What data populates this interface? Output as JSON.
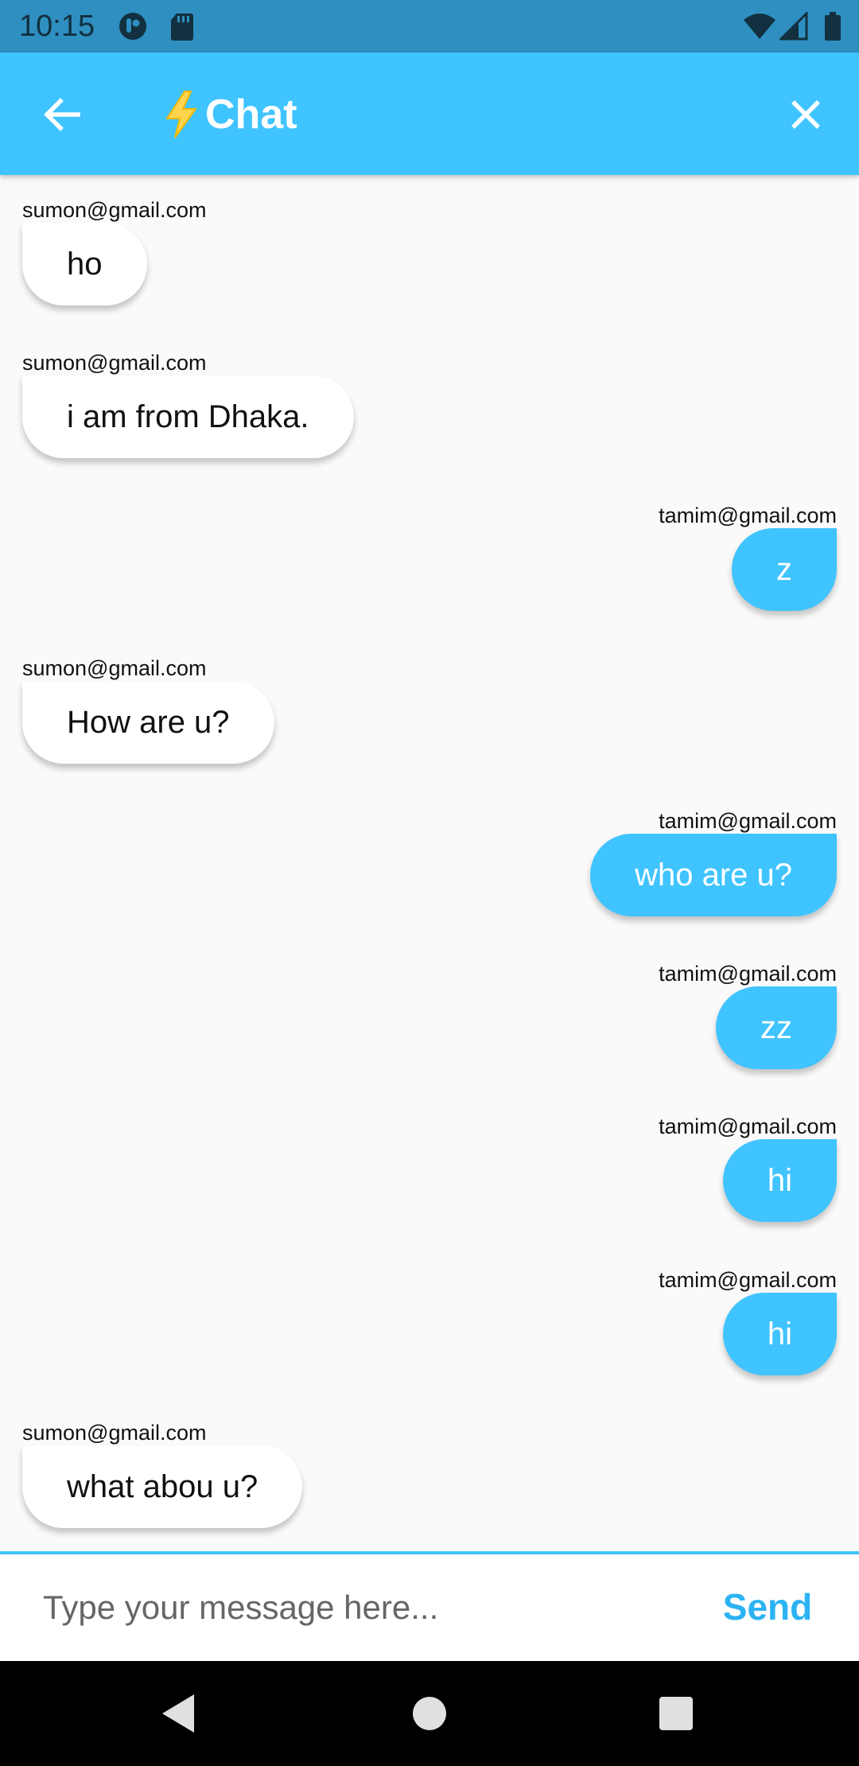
{
  "status_bar": {
    "time": "10:15",
    "icons": [
      "app-notification-icon",
      "sd-card-icon",
      "wifi-icon",
      "cellular-signal-icon",
      "battery-icon"
    ]
  },
  "app_bar": {
    "title": "Chat",
    "title_icon": "lightning-bolt-icon",
    "back_icon": "arrow-back-icon",
    "close_icon": "close-icon",
    "background": "#40C4FF",
    "bolt_color": "#FFD54F"
  },
  "messages": [
    {
      "sender": "sumon@gmail.com",
      "text": "ho",
      "direction": "received"
    },
    {
      "sender": "sumon@gmail.com",
      "text": "i am from Dhaka.",
      "direction": "received"
    },
    {
      "sender": "tamim@gmail.com",
      "text": "z",
      "direction": "sent"
    },
    {
      "sender": "sumon@gmail.com",
      "text": "How are u?",
      "direction": "received"
    },
    {
      "sender": "tamim@gmail.com",
      "text": "who are u?",
      "direction": "sent"
    },
    {
      "sender": "tamim@gmail.com",
      "text": "zz",
      "direction": "sent"
    },
    {
      "sender": "tamim@gmail.com",
      "text": "hi",
      "direction": "sent"
    },
    {
      "sender": "tamim@gmail.com",
      "text": "hi",
      "direction": "sent"
    },
    {
      "sender": "sumon@gmail.com",
      "text": "what abou u?",
      "direction": "received"
    }
  ],
  "composer": {
    "placeholder": "Type your message here...",
    "value": "",
    "send_label": "Send"
  },
  "nav_bar": {
    "buttons": [
      "nav-back-icon",
      "nav-home-icon",
      "nav-recents-icon"
    ]
  },
  "colors": {
    "accent": "#40C4FF",
    "status_bar": "#2E8FC0",
    "chat_background": "#FAFAFA",
    "received_bubble": "#FFFFFF",
    "sent_bubble": "#40C4FF"
  }
}
